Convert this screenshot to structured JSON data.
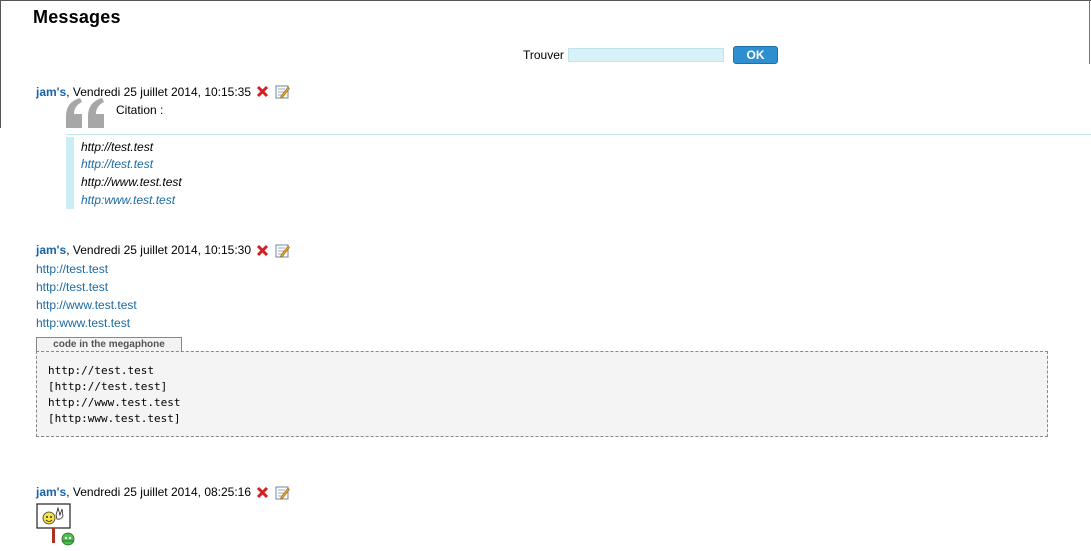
{
  "page": {
    "title": "Messages"
  },
  "search": {
    "label": "Trouver",
    "value": "",
    "button_label": "OK"
  },
  "messages": [
    {
      "author": "jam's",
      "date": ", Vendredi 25 juillet 2014, 10:15:35",
      "quote": {
        "label": "Citation :",
        "lines": [
          "http://test.test",
          "http://test.test",
          "http://www.test.test",
          "http:www.test.test"
        ]
      }
    },
    {
      "author": "jam's",
      "date": ", Vendredi 25 juillet 2014, 10:15:30",
      "lines": [
        "http://test.test",
        "http://test.test",
        "http://www.test.test",
        "http:www.test.test"
      ],
      "code": {
        "tab_label": "code in the megaphone",
        "lines": [
          "http://test.test",
          "[http://test.test]",
          "http://www.test.test",
          "[http:www.test.test]"
        ]
      }
    },
    {
      "author": "jam's",
      "date": ", Vendredi 25 juillet 2014, 08:25:16"
    }
  ],
  "icons": {
    "delete": "delete-x-icon",
    "edit": "edit-pencil-icon",
    "quote": "quote-mark-icon",
    "smiley": "smiley-sign-icon"
  },
  "colors": {
    "author": "#1565a8",
    "link": "#1a6aa5",
    "button": "#2e8fd0",
    "search_bg": "#d6f1f7",
    "quote_bar": "#cbeef5"
  }
}
